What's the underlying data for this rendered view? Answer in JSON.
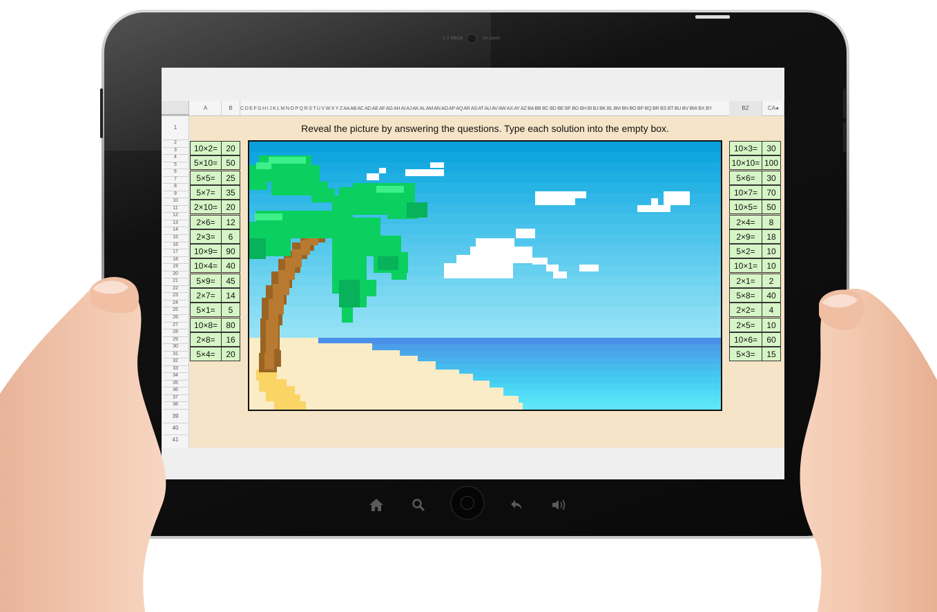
{
  "sheet": {
    "instruction": "Reveal the picture by answering the questions. Type each solution into the empty box.",
    "columns": {
      "a": "A",
      "b": "B",
      "middle": "C D E F G H I J K L M N O P Q R S T U V W X Y Z AA AB AC AD AE AF AG AH AI AJ AK AL AM AN AO AP AQ AR AS AT AU AV AW AX AY AZ BA BB BC BD BE BF BG BH BI BJ BK BL BM BN BO BP BQ BR BS BT BU BV BW BX BY",
      "bz": "BZ",
      "ca": "CA◂"
    },
    "rows_top": [
      "1"
    ],
    "rows_small": [
      "2",
      "3",
      "4",
      "5",
      "6",
      "7",
      "8",
      "9",
      "10",
      "11",
      "12",
      "13",
      "14",
      "15",
      "16",
      "17",
      "18",
      "19",
      "20",
      "21",
      "22",
      "23",
      "24",
      "25",
      "26",
      "27",
      "28",
      "29",
      "30",
      "31",
      "32",
      "33",
      "34",
      "35",
      "36",
      "37",
      "38"
    ],
    "rows_bottom": [
      "39",
      "40",
      "41"
    ]
  },
  "left_questions": [
    {
      "q": "10×2=",
      "a": "20"
    },
    {
      "q": "5×10=",
      "a": "50"
    },
    {
      "q": "5×5=",
      "a": "25"
    },
    {
      "q": "5×7=",
      "a": "35"
    },
    {
      "q": "2×10=",
      "a": "20"
    },
    {
      "q": "2×6=",
      "a": "12"
    },
    {
      "q": "2×3=",
      "a": "6"
    },
    {
      "q": "10×9=",
      "a": "90"
    },
    {
      "q": "10×4=",
      "a": "40"
    },
    {
      "q": "5×9=",
      "a": "45"
    },
    {
      "q": "2×7=",
      "a": "14"
    },
    {
      "q": "5×1=",
      "a": "5"
    },
    {
      "q": "10×8=",
      "a": "80"
    },
    {
      "q": "2×8=",
      "a": "16"
    },
    {
      "q": "5×4=",
      "a": "20"
    }
  ],
  "right_questions": [
    {
      "q": "10×3=",
      "a": "30"
    },
    {
      "q": "10×10=",
      "a": "100"
    },
    {
      "q": "5×6=",
      "a": "30"
    },
    {
      "q": "10×7=",
      "a": "70"
    },
    {
      "q": "10×5=",
      "a": "50"
    },
    {
      "q": "2×4=",
      "a": "8"
    },
    {
      "q": "2×9=",
      "a": "18"
    },
    {
      "q": "5×2=",
      "a": "10"
    },
    {
      "q": "10×1=",
      "a": "10"
    },
    {
      "q": "2×1=",
      "a": "2"
    },
    {
      "q": "5×8=",
      "a": "40"
    },
    {
      "q": "2×2=",
      "a": "4"
    },
    {
      "q": "2×5=",
      "a": "10"
    },
    {
      "q": "10×6=",
      "a": "60"
    },
    {
      "q": "5×3=",
      "a": "15"
    }
  ],
  "device": {
    "camera_text_left": "5.0 MEGA",
    "camera_text_right": "3x zoom",
    "nav_icons": [
      "home-icon",
      "search-icon",
      "home-button",
      "back-icon",
      "volume-icon"
    ]
  },
  "colors": {
    "sheet_bg": "#f6e4c8",
    "cell_green": "#d6f5c6",
    "sky_top": "#0aa0dc",
    "sea": "#4a9fe8",
    "sand": "#f9ecc6",
    "palm_leaf": "#0bcf5f",
    "trunk": "#a8702a"
  }
}
